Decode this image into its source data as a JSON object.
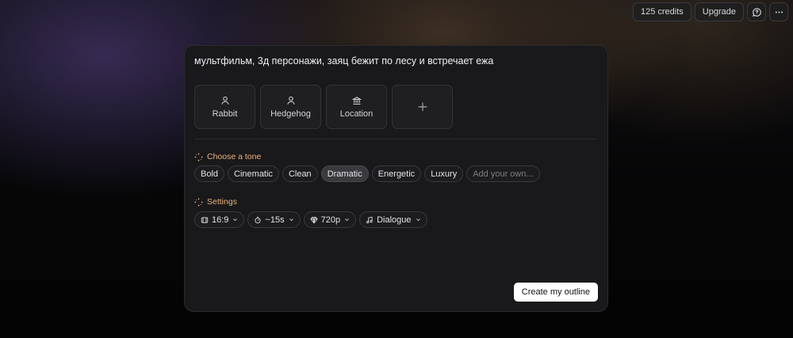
{
  "topbar": {
    "credits": "125 credits",
    "upgrade": "Upgrade",
    "help_icon": "chat-help-icon",
    "more_icon": "more-horizontal-icon"
  },
  "prompt": "мультфильм, 3д персонажи, заяц бежит по лесу и встречает ежа",
  "characters": [
    {
      "label": "Rabbit",
      "icon": "person-icon"
    },
    {
      "label": "Hedgehog",
      "icon": "person-icon"
    },
    {
      "label": "Location",
      "icon": "landmark-icon"
    }
  ],
  "tone": {
    "title": "Choose a tone",
    "options": [
      "Bold",
      "Cinematic",
      "Clean",
      "Dramatic",
      "Energetic",
      "Luxury"
    ],
    "selected": "Dramatic",
    "custom_placeholder": "Add your own..."
  },
  "settings": {
    "title": "Settings",
    "items": [
      {
        "label": "16:9",
        "icon": "aspect-ratio-icon"
      },
      {
        "label": "~15s",
        "icon": "timer-icon"
      },
      {
        "label": "720p",
        "icon": "diamond-icon"
      },
      {
        "label": "Dialogue",
        "icon": "music-note-icon"
      }
    ]
  },
  "actions": {
    "create": "Create my outline"
  },
  "colors": {
    "accent": "#e9b27a",
    "card_bg": "#19191b",
    "button_bg": "#ffffff"
  }
}
